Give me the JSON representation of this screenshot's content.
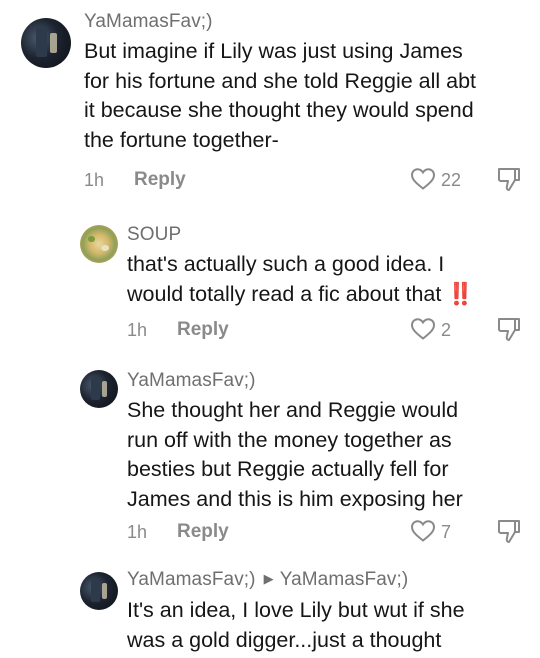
{
  "comments": [
    {
      "username": "YaMamasFav;)",
      "lines": [
        "But imagine if Lily was just using James",
        "for his fortune and she told Reggie all abt",
        "it because she thought they would spend",
        "the fortune together-"
      ],
      "time": "1h",
      "reply_label": "Reply",
      "likes": "22",
      "avatar_icon": "profile-photo-city"
    },
    {
      "username": "SOUP",
      "lines": [
        "that's actually such a good idea. I",
        "would totally read a fic about that"
      ],
      "emoji": "‼️",
      "time": "1h",
      "reply_label": "Reply",
      "likes": "2",
      "avatar_icon": "profile-photo-food"
    },
    {
      "username": "YaMamasFav;)",
      "lines": [
        "She thought her and Reggie would",
        "run off with the money together as",
        "besties but Reggie actually fell for",
        "James and this is him exposing her"
      ],
      "time": "1h",
      "reply_label": "Reply",
      "likes": "7",
      "avatar_icon": "profile-photo-city"
    },
    {
      "username": "YaMamasFav;)",
      "reply_to": "YaMamasFav;)",
      "lines": [
        "It's an idea, I love Lily but wut if she",
        "was a gold digger...just a thought"
      ],
      "avatar_icon": "profile-photo-city"
    }
  ],
  "colors": {
    "text": "#161616",
    "muted": "#8a8a8a",
    "username": "#6f6f6f",
    "emoji_red": "#e02020"
  }
}
